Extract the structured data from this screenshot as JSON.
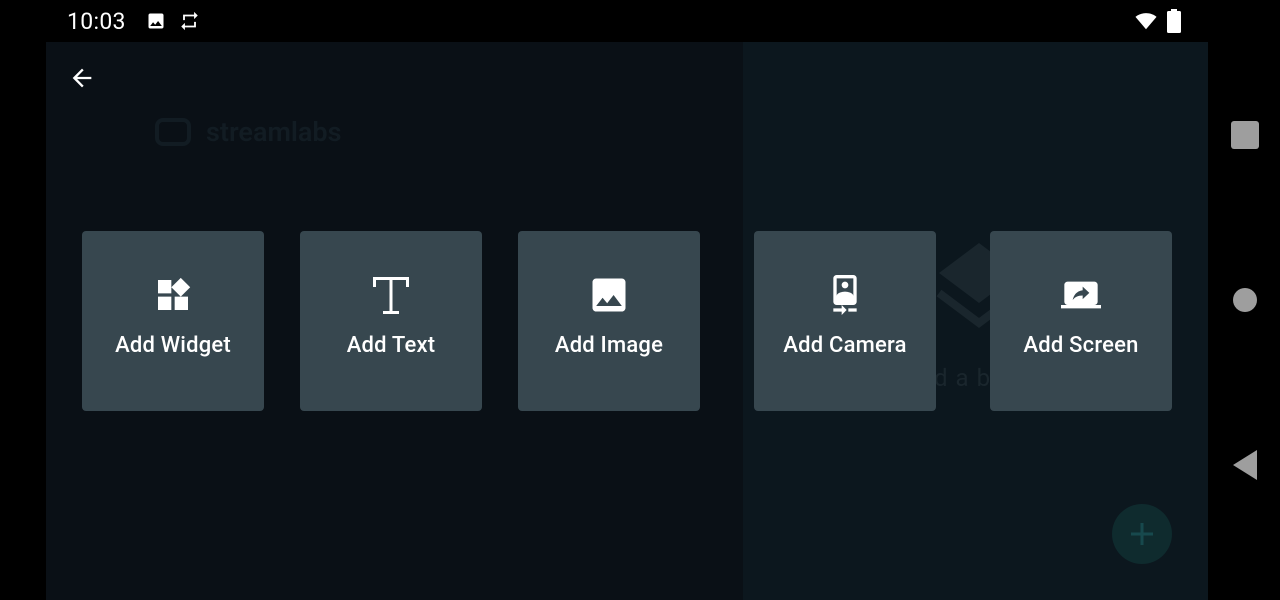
{
  "status_bar": {
    "time": "10:03",
    "icons": [
      "image-icon",
      "sync-icon",
      "wifi-icon",
      "battery-icon"
    ]
  },
  "app": {
    "back_icon": "arrow-left-icon",
    "background_texts": {
      "logo_text": "streamlabs",
      "stack_text": "dab"
    },
    "tiles": [
      {
        "label": "Add Widget",
        "icon": "widgets-icon"
      },
      {
        "label": "Add Text",
        "icon": "text-icon"
      },
      {
        "label": "Add Image",
        "icon": "image-icon"
      },
      {
        "label": "Add Camera",
        "icon": "camera-icon"
      },
      {
        "label": "Add Screen",
        "icon": "screen-share-icon"
      }
    ],
    "fab_icon": "plus-icon"
  },
  "nav_bar": {
    "buttons": [
      "recents-button",
      "home-button",
      "back-button"
    ]
  },
  "colors": {
    "tile_bg": "#37474f",
    "app_bg": "#0a1016",
    "panel_bg": "#0c171e",
    "fab_bg": "#0f2b2e",
    "text": "#ffffff"
  }
}
